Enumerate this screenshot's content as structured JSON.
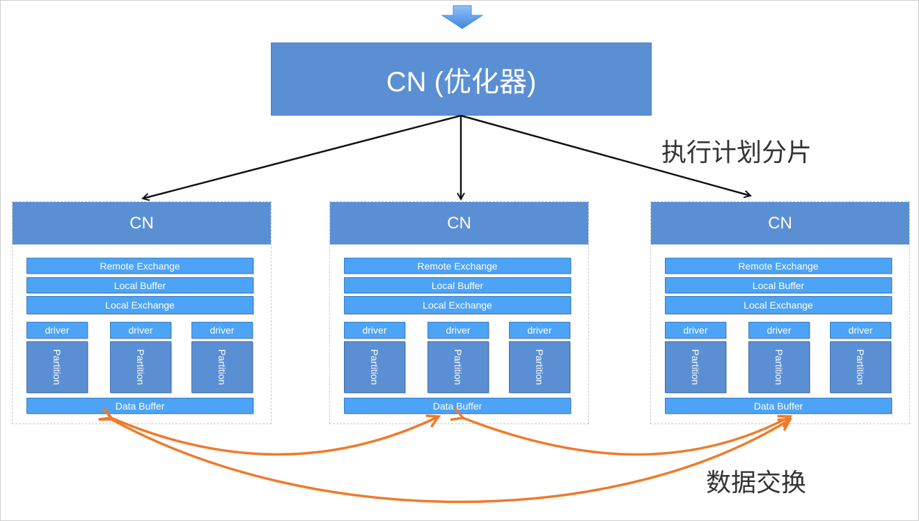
{
  "main": {
    "title": "CN (优化器)"
  },
  "labels": {
    "plan_split": "执行计划分片",
    "data_exchange": "数据交换"
  },
  "nodes": [
    {
      "title": "CN",
      "remote_exchange": "Remote Exchange",
      "local_buffer": "Local Buffer",
      "local_exchange": "Local Exchange",
      "drivers": [
        "driver",
        "driver",
        "driver"
      ],
      "partitions": [
        "Partition",
        "Partition",
        "Partition"
      ],
      "data_buffer": "Data Buffer"
    },
    {
      "title": "CN",
      "remote_exchange": "Remote Exchange",
      "local_buffer": "Local Buffer",
      "local_exchange": "Local Exchange",
      "drivers": [
        "driver",
        "driver",
        "driver"
      ],
      "partitions": [
        "Partition",
        "Partition",
        "Partition"
      ],
      "data_buffer": "Data Buffer"
    },
    {
      "title": "CN",
      "remote_exchange": "Remote Exchange",
      "local_buffer": "Local Buffer",
      "local_exchange": "Local Exchange",
      "drivers": [
        "driver",
        "driver",
        "driver"
      ],
      "partitions": [
        "Partition",
        "Partition",
        "Partition"
      ],
      "data_buffer": "Data Buffer"
    }
  ],
  "colors": {
    "node_header": "#5b8fd4",
    "component_bar": "#4da3f5",
    "plan_arrow": "#111111",
    "exchange_arrow": "#f07a2a",
    "top_arrow": "#4a90e2"
  }
}
